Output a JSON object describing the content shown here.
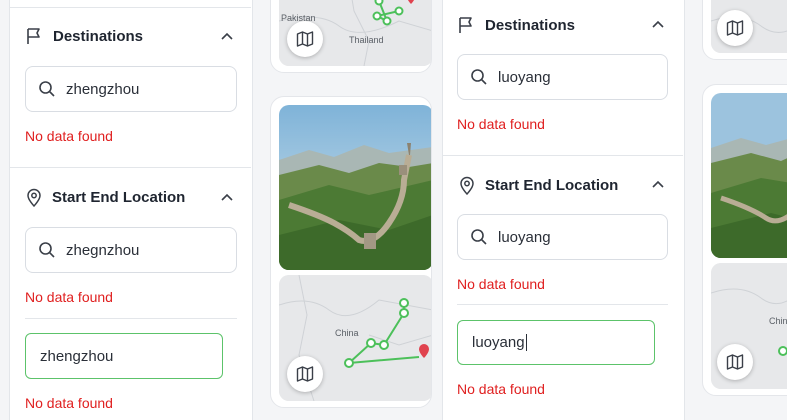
{
  "left_panel": {
    "destinations": {
      "title": "Destinations",
      "search_value": "zhengzhou",
      "no_data": "No data found"
    },
    "start_end": {
      "title": "Start End Location",
      "search_value": "zhegnzhou",
      "no_data": "No data found",
      "input_value": "zhengzhou",
      "input_no_data": "No data found"
    }
  },
  "right_panel": {
    "destinations": {
      "title": "Destinations",
      "search_value": "luoyang",
      "no_data": "No data found"
    },
    "start_end": {
      "title": "Start End Location",
      "search_value": "luoyang",
      "no_data": "No data found",
      "input_value": "luoyang",
      "input_no_data": "No data found"
    }
  },
  "map_labels": {
    "pakistan": "Pakistan",
    "thailand": "Thailand",
    "china": "China"
  },
  "colors": {
    "error": "#e02020",
    "active_border": "#5cc36a",
    "route": "#4cc05a"
  },
  "icons": [
    "flag-icon",
    "map-pin-icon",
    "search-icon",
    "chevron-up-icon",
    "map-icon"
  ]
}
